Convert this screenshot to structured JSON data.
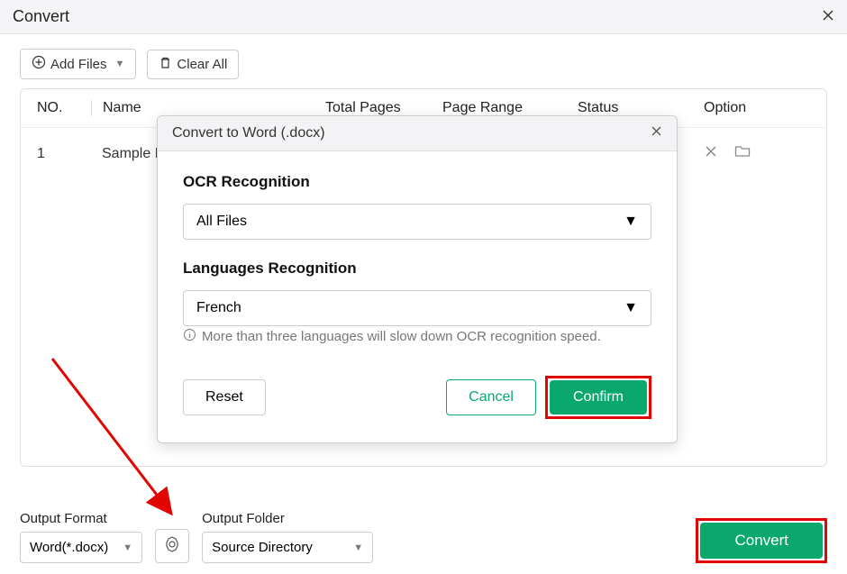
{
  "window": {
    "title": "Convert"
  },
  "toolbar": {
    "add_files": "Add Files",
    "clear_all": "Clear All"
  },
  "table": {
    "headers": {
      "no": "NO.",
      "name": "Name",
      "total_pages": "Total Pages",
      "page_range": "Page Range",
      "status": "Status",
      "option": "Option"
    },
    "rows": [
      {
        "no": "1",
        "name": "Sample F"
      }
    ]
  },
  "bottom": {
    "output_format_label": "Output Format",
    "output_format_value": "Word(*.docx)",
    "output_folder_label": "Output Folder",
    "output_folder_value": "Source Directory",
    "convert": "Convert"
  },
  "modal": {
    "title": "Convert to Word (.docx)",
    "ocr_title": "OCR Recognition",
    "ocr_value": "All Files",
    "lang_title": "Languages Recognition",
    "lang_value": "French",
    "hint": "More than three languages will slow down OCR recognition speed.",
    "reset": "Reset",
    "cancel": "Cancel",
    "confirm": "Confirm"
  }
}
